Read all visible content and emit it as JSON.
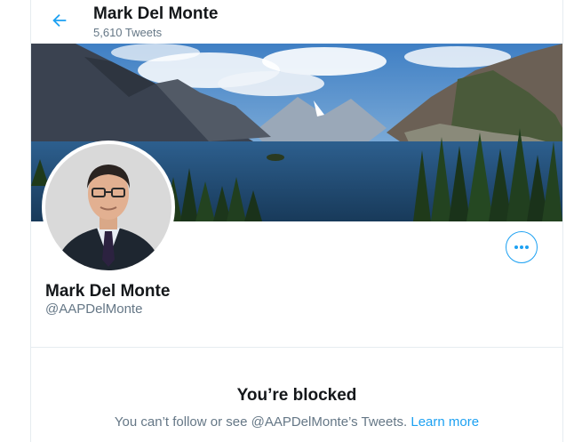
{
  "header": {
    "title": "Mark Del Monte",
    "tweet_count": "5,610 Tweets"
  },
  "profile": {
    "name": "Mark Del Monte",
    "handle": "@AAPDelMonte"
  },
  "blocked": {
    "title": "You’re blocked",
    "message": "You can’t follow or see @AAPDelMonte’s Tweets.",
    "link": "Learn more"
  },
  "icons": {
    "back": "arrow-left-icon",
    "more": "more-horizontal-icon"
  },
  "colors": {
    "accent": "#1da1f2",
    "text": "#14171a",
    "secondary": "#657786",
    "border": "#e6ecf0"
  }
}
